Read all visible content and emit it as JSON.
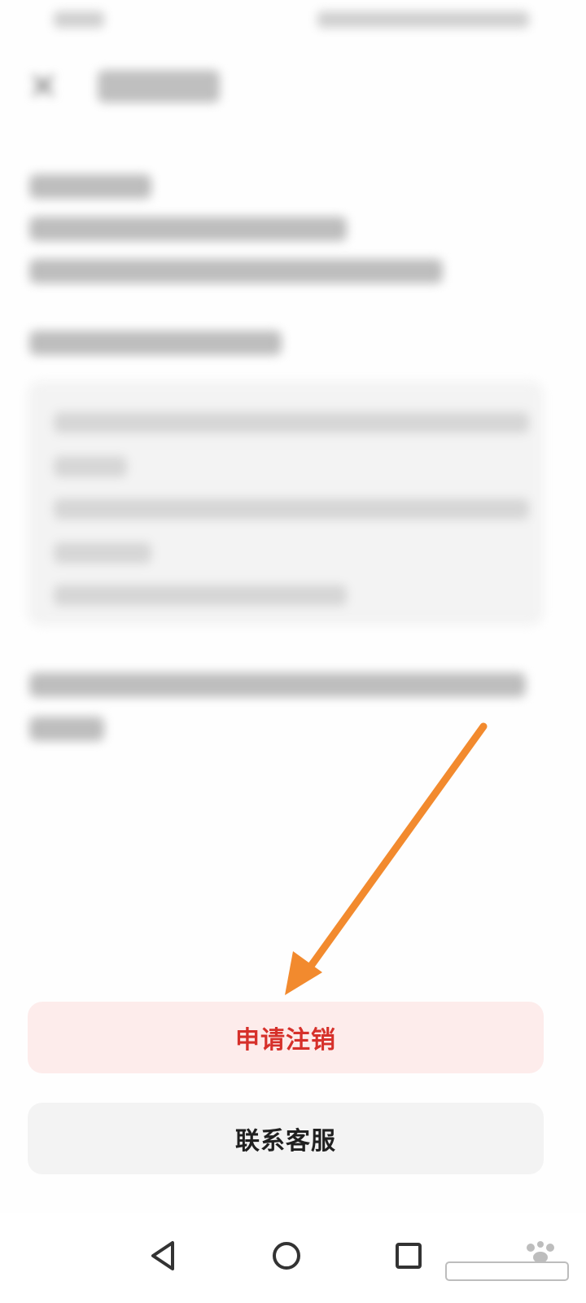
{
  "actions": {
    "apply_cancellation": "申请注销",
    "contact_support": "联系客服"
  },
  "navigation": {
    "back_icon": "triangle-back-icon",
    "home_icon": "circle-home-icon",
    "recent_icon": "square-recent-icon"
  },
  "colors": {
    "apply_bg": "#fdeceb",
    "apply_text": "#d6302a",
    "contact_bg": "#f3f3f3",
    "arrow": "#f28a2e"
  }
}
